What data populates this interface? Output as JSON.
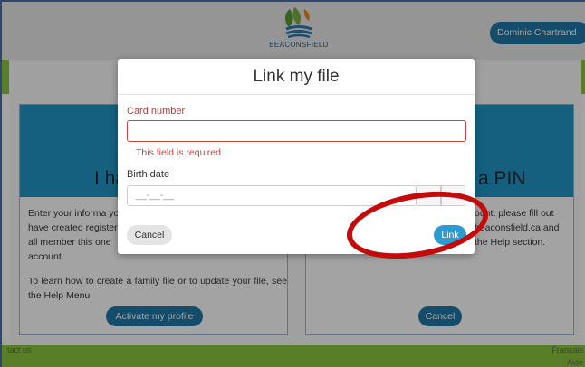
{
  "header": {
    "logo_text": "BEACONSFIELD",
    "user_name": "Dominic Chartrand"
  },
  "cards": {
    "left": {
      "title": "I ha",
      "intro": "Enter your informa you have created register all member this one account.",
      "help": "To learn how to create a family file or to update your file, see the Help Menu",
      "button": "Activate my profile"
    },
    "right": {
      "title": "a PIN",
      "intro": "ount, please fill out beaconsfield.ca and the Help section.",
      "button": "Cancel"
    }
  },
  "footer": {
    "contact": "tact us",
    "language": "Français",
    "help": "Aide"
  },
  "modal": {
    "title": "Link my file",
    "card_number_label": "Card number",
    "card_number_value": "",
    "error": "This field is required",
    "birth_date_label": "Birth date",
    "birth_date_placeholder": "__-__-__",
    "clear_icon": "×",
    "calendar_icon": "▾",
    "cancel_label": "Cancel",
    "link_label": "Link"
  },
  "colors": {
    "brand_blue": "#1e79a8",
    "card_header_blue": "#2196c7",
    "green": "#8cc63f",
    "error_red": "#c94343",
    "annotation_red": "#c40b0b"
  }
}
